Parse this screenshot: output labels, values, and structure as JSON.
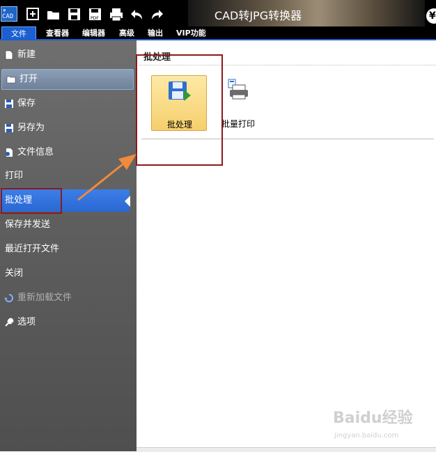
{
  "window": {
    "title": "CAD转JPG转换器",
    "app_icon_text": "CAD",
    "currency_symbol": "¥"
  },
  "quick_access": [
    "new-icon",
    "open-folder-icon",
    "save-icon",
    "save-as-pdf-icon",
    "print-icon",
    "undo-icon",
    "redo-icon"
  ],
  "menubar": {
    "items": [
      {
        "label": "文件",
        "active": true
      },
      {
        "label": "查看器"
      },
      {
        "label": "编辑器"
      },
      {
        "label": "高级"
      },
      {
        "label": "输出"
      },
      {
        "label": "VIP功能"
      }
    ]
  },
  "sidebar": {
    "items": [
      {
        "label": "新建",
        "icon": "new-file-icon"
      },
      {
        "label": "打开",
        "icon": "open-folder-icon",
        "state": "hover"
      },
      {
        "label": "保存",
        "icon": "save-icon"
      },
      {
        "label": "另存为",
        "icon": "save-as-icon"
      },
      {
        "label": "文件信息",
        "icon": "file-info-icon"
      },
      {
        "label": "打印"
      },
      {
        "label": "批处理",
        "state": "selected"
      },
      {
        "label": "保存并发送"
      },
      {
        "label": "最近打开文件"
      },
      {
        "label": "关闭"
      },
      {
        "label": "重新加载文件",
        "icon": "reload-icon",
        "state": "disabled"
      },
      {
        "label": "选项",
        "icon": "wrench-icon"
      }
    ]
  },
  "content": {
    "section_title": "批处理",
    "buttons": [
      {
        "label": "批处理",
        "icon": "batch-save-icon",
        "state": "selected"
      },
      {
        "label": "批量打印",
        "icon": "batch-print-icon"
      }
    ]
  },
  "colors": {
    "accent": "#1b5fd1",
    "annotation_red": "#8b1a1a",
    "arrow": "#f08a3c",
    "tile": "#f6cf6c"
  },
  "watermark": {
    "brand": "Baidu经验",
    "url": "jingyan.baidu.com"
  }
}
